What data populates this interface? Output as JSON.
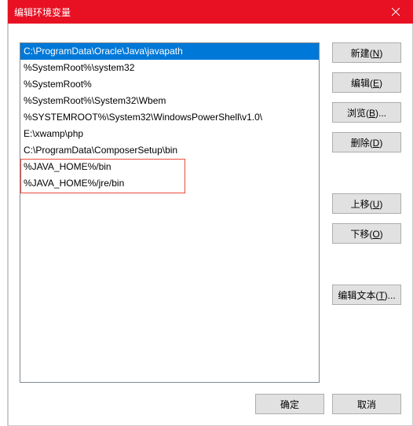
{
  "title": "编辑环境变量",
  "list": {
    "items": [
      "C:\\ProgramData\\Oracle\\Java\\javapath",
      "%SystemRoot%\\system32",
      "%SystemRoot%",
      "%SystemRoot%\\System32\\Wbem",
      "%SYSTEMROOT%\\System32\\WindowsPowerShell\\v1.0\\",
      "E:\\xwamp\\php",
      "C:\\ProgramData\\ComposerSetup\\bin",
      "%JAVA_HOME%/bin",
      "%JAVA_HOME%/jre/bin"
    ],
    "selected_index": 0,
    "highlight_start": 7,
    "highlight_end": 8
  },
  "buttons": {
    "new_": "新建(",
    "new_key": "N",
    "edit": "编辑(",
    "edit_key": "E",
    "browse": "浏览(",
    "browse_key": "B",
    "delete": "删除(",
    "delete_key": "D",
    "moveup": "上移(",
    "moveup_key": "U",
    "movedown": "下移(",
    "movedown_key": "O",
    "edittext": "编辑文本(",
    "edittext_key": "T",
    "close_paren": ")",
    "close_paren_ell": ")...",
    "ok": "确定",
    "cancel": "取消"
  }
}
